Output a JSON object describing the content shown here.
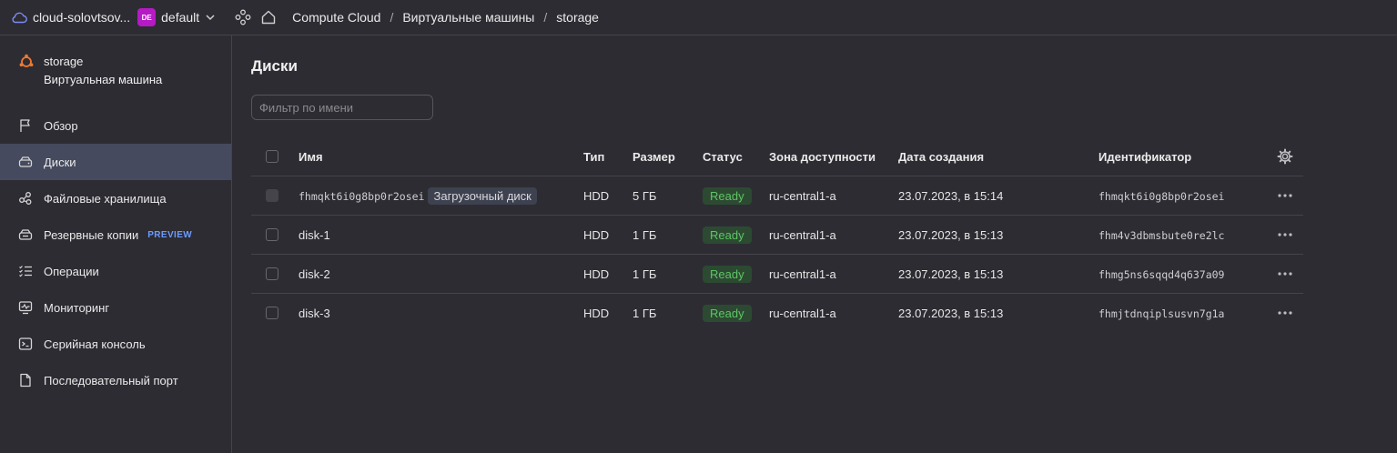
{
  "topbar": {
    "cloud_name": "cloud-solovtsov...",
    "folder_badge": "DE",
    "folder_name": "default",
    "breadcrumbs": [
      {
        "label": "Compute Cloud"
      },
      {
        "label": "Виртуальные машины"
      },
      {
        "label": "storage"
      }
    ],
    "separator": "/"
  },
  "sidebar": {
    "vm_name": "storage",
    "vm_type": "Виртуальная машина",
    "items": [
      {
        "label": "Обзор",
        "icon": "flag-icon"
      },
      {
        "label": "Диски",
        "icon": "disk-icon",
        "active": true
      },
      {
        "label": "Файловые хранилища",
        "icon": "file-storage-icon"
      },
      {
        "label": "Резервные копии",
        "icon": "backup-icon",
        "badge": "PREVIEW"
      },
      {
        "label": "Операции",
        "icon": "operations-list-icon"
      },
      {
        "label": "Мониторинг",
        "icon": "monitoring-icon"
      },
      {
        "label": "Серийная консоль",
        "icon": "terminal-icon"
      },
      {
        "label": "Последовательный порт",
        "icon": "file-icon"
      }
    ]
  },
  "main": {
    "title": "Диски",
    "filter_placeholder": "Фильтр по имени",
    "columns": {
      "name": "Имя",
      "type": "Тип",
      "size": "Размер",
      "status": "Статус",
      "zone": "Зона доступности",
      "created": "Дата создания",
      "id": "Идентификатор"
    },
    "rows": [
      {
        "name": "fhmqkt6i0g8bp0r2osei",
        "tag": "Загрузочный диск",
        "type": "HDD",
        "size": "5 ГБ",
        "status": "Ready",
        "zone": "ru-central1-a",
        "created": "23.07.2023, в 15:14",
        "id": "fhmqkt6i0g8bp0r2osei"
      },
      {
        "name": "disk-1",
        "type": "HDD",
        "size": "1 ГБ",
        "status": "Ready",
        "zone": "ru-central1-a",
        "created": "23.07.2023, в 15:13",
        "id": "fhm4v3dbmsbute0re2lc"
      },
      {
        "name": "disk-2",
        "type": "HDD",
        "size": "1 ГБ",
        "status": "Ready",
        "zone": "ru-central1-a",
        "created": "23.07.2023, в 15:13",
        "id": "fhmg5ns6sqqd4q637a09"
      },
      {
        "name": "disk-3",
        "type": "HDD",
        "size": "1 ГБ",
        "status": "Ready",
        "zone": "ru-central1-a",
        "created": "23.07.2023, в 15:13",
        "id": "fhmjtdnqiplsusvn7g1a"
      }
    ]
  },
  "colors": {
    "background": "#2d2c33",
    "active_nav": "#454a5e",
    "folder_badge": "#b51ac4",
    "status_ready_bg": "#2c4a31",
    "status_ready_text": "#5fc466",
    "preview_badge": "#6c9bff",
    "vm_icon": "#f07a30"
  }
}
